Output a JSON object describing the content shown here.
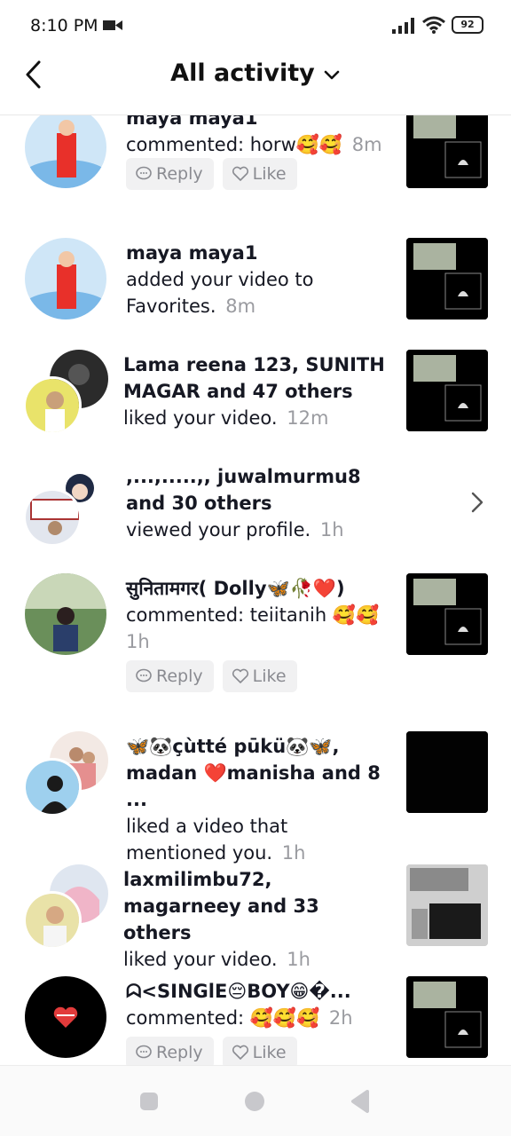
{
  "status_bar": {
    "time": "8:10 PM",
    "battery": "92"
  },
  "header": {
    "title": "All activity"
  },
  "buttons": {
    "reply": "Reply",
    "like": "Like"
  },
  "items": [
    {
      "names": "maya maya1",
      "action": "commented: horw🥰🥰",
      "time": "8m"
    },
    {
      "names": "maya maya1",
      "action": "added your video to Favorites.",
      "time": "8m"
    },
    {
      "names": "Lama reena 123, SUNITH MAGAR and 47 others",
      "action": "liked your video.",
      "time": "12m"
    },
    {
      "names": ",...,.....,, juwalmurmu8 and 30 others",
      "action": "viewed your profile.",
      "time": "1h"
    },
    {
      "names": "सुनितामगर( Dolly🦋🥀❤️)",
      "action": "commented: teiitanih 🥰🥰",
      "time": "1h"
    },
    {
      "names": "🦋🐼çùtté pūkü🐼🦋, madan ❤️manisha and 8 ...",
      "action": "liked a video that mentioned you.",
      "time": "1h"
    },
    {
      "names": "laxmilimbu72, magarneey and 33 others",
      "action": "liked your video.",
      "time": "1h"
    },
    {
      "names": "ᗣ<SINGlE😔BOY😁�...",
      "action": "commented: 🥰🥰🥰",
      "time": "2h"
    }
  ]
}
